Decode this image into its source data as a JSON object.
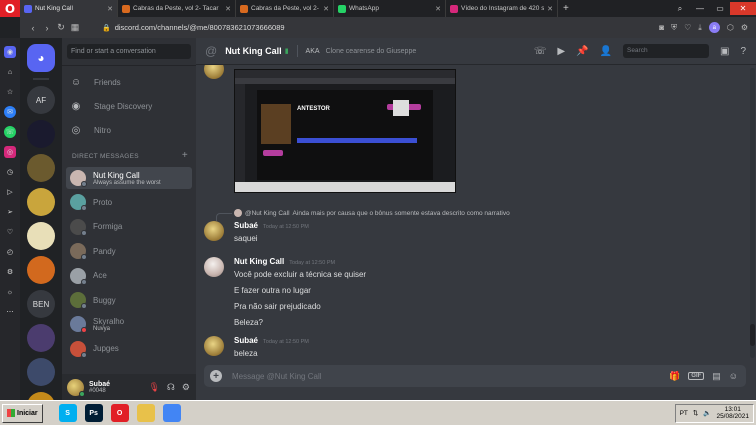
{
  "browser": {
    "tabs": [
      {
        "title": "Nut King Call",
        "icon_color": "#5865f2",
        "active": true
      },
      {
        "title": "Cabras da Peste, vol 2- Tacar",
        "icon_color": "#d96a1f",
        "active": false
      },
      {
        "title": "Cabras da Peste, vol 2- Tacar",
        "icon_color": "#d96a1f",
        "active": false
      },
      {
        "title": "WhatsApp",
        "icon_color": "#25d366",
        "active": false
      },
      {
        "title": "Vídeo do Instagram de 420 su",
        "icon_color": "#d6287b",
        "active": false
      }
    ],
    "url_path": "discord.com/channels/@me/800783621073666089",
    "url_host": "discord.com"
  },
  "servers": {
    "items": [
      {
        "label": "",
        "color": "#5865f2",
        "icon": "discord-icon",
        "home": true
      },
      {
        "label": "AF",
        "color": "#36393f"
      },
      {
        "label": "",
        "color": "#1a1a2e",
        "icon": "server-icon"
      },
      {
        "label": "",
        "color": "#6b5a2e",
        "icon": "server-icon"
      },
      {
        "label": "",
        "color": "#c9a53c",
        "icon": "server-icon"
      },
      {
        "label": "",
        "color": "#e8dfb8",
        "icon": "server-icon"
      },
      {
        "label": "",
        "color": "#d2691e",
        "icon": "server-icon"
      },
      {
        "label": "BEN",
        "color": "#36393f"
      },
      {
        "label": "",
        "color": "#4b3c6e",
        "icon": "server-icon"
      },
      {
        "label": "",
        "color": "#3d4a6a",
        "icon": "server-icon"
      },
      {
        "label": "",
        "color": "#c58a1a",
        "icon": "server-icon"
      }
    ]
  },
  "dm_sidebar": {
    "search_placeholder": "Find or start a conversation",
    "nav": [
      {
        "label": "Friends",
        "icon": "friends-icon"
      },
      {
        "label": "Stage Discovery",
        "icon": "stage-icon"
      },
      {
        "label": "Nitro",
        "icon": "nitro-icon"
      }
    ],
    "header": "DIRECT MESSAGES",
    "dms": [
      {
        "name": "Nut King Call",
        "sub": "Always assume the worst",
        "color": "#c9b6b0",
        "active": true,
        "status": "#747f8d"
      },
      {
        "name": "Proto",
        "sub": "",
        "color": "#5aa0a0",
        "status": "#747f8d"
      },
      {
        "name": "Formiga",
        "sub": "",
        "color": "#4b4b4b",
        "status": "#747f8d"
      },
      {
        "name": "Pandy",
        "sub": "",
        "color": "#7a6a5a",
        "status": "#747f8d"
      },
      {
        "name": "Ace",
        "sub": "",
        "color": "#9aa0a6",
        "status": "#747f8d"
      },
      {
        "name": "Buggy",
        "sub": "",
        "color": "#5c6e3a",
        "status": "#747f8d"
      },
      {
        "name": "Skyralho",
        "sub": "Nuvya",
        "color": "#6a7a9a",
        "status": "#ed4245"
      },
      {
        "name": "Jupges",
        "sub": "",
        "color": "#c8503a",
        "status": "#747f8d"
      }
    ]
  },
  "user_panel": {
    "name": "Subaé",
    "tag": "#0048"
  },
  "chat": {
    "title": "Nut King Call",
    "aka_label": "AKA",
    "aka_value": "Clone cearense do Giuseppe",
    "search_placeholder": "Search",
    "embed_title": "ANTESTOR",
    "reply": {
      "author": "@Nut King Call",
      "text": "Ainda mais por causa que o bônus somente estava descrito como narrativo"
    },
    "messages": [
      {
        "author": "Subaé",
        "time": "Today at 12:50 PM",
        "lines": [
          "saquei"
        ],
        "avatar": "subae"
      },
      {
        "author": "Nut King Call",
        "time": "Today at 12:50 PM",
        "lines": [
          "Você pode excluir a técnica se quiser",
          "E fazer outra no lugar",
          "Pra não sair prejudicado",
          "Beleza?"
        ],
        "avatar": "nut"
      },
      {
        "author": "Subaé",
        "time": "Today at 12:50 PM",
        "lines": [
          "beleza"
        ],
        "avatar": "subae"
      }
    ],
    "composer_placeholder": "Message @Nut King Call",
    "gif_label": "GIF"
  },
  "taskbar": {
    "start_label": "Iniciar",
    "apps": [
      {
        "label": "S",
        "color": "#00aff0",
        "icon": "skype-icon"
      },
      {
        "label": "Ps",
        "color": "#001d34",
        "icon": "photoshop-icon"
      },
      {
        "label": "O",
        "color": "#e11f26",
        "icon": "opera-icon"
      },
      {
        "label": "",
        "color": "#e8c14a",
        "icon": "folder-icon"
      },
      {
        "label": "",
        "color": "#4285f4",
        "icon": "chrome-icon"
      }
    ],
    "lang": "PT",
    "time": "13:01",
    "date": "25/08/2021"
  }
}
